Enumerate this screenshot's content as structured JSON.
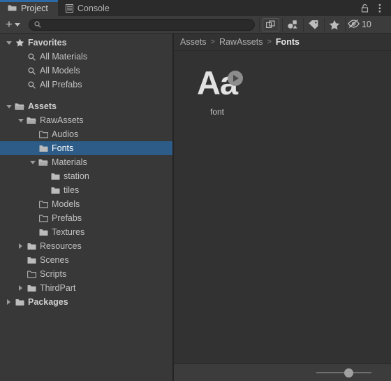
{
  "window": {
    "tabs": [
      {
        "label": "Project",
        "icon": "folder-icon",
        "active": true
      },
      {
        "label": "Console",
        "icon": "console-list-icon",
        "active": false
      }
    ],
    "lock_icon": "padlock-icon",
    "menu_icon": "kebab-menu-icon"
  },
  "toolbar": {
    "add_label": "+",
    "add_dropdown_icon": "chevron-down-icon",
    "search_value": "",
    "search_placeholder": "",
    "search_icon": "search-icon",
    "icons": [
      {
        "name": "open-in-new-window-icon"
      },
      {
        "name": "asset-type-filter-icon"
      },
      {
        "name": "label-tag-icon"
      },
      {
        "name": "favorite-star-icon"
      }
    ],
    "hidden_icon": "eye-slash-icon",
    "hidden_count": "10"
  },
  "tree": {
    "items": [
      {
        "label": "Favorites",
        "indent": 0,
        "twisty": "down",
        "icon": "star-icon",
        "bold": true,
        "selected": false
      },
      {
        "label": "All Materials",
        "indent": 1,
        "twisty": "none",
        "icon": "search-icon",
        "bold": false,
        "selected": false
      },
      {
        "label": "All Models",
        "indent": 1,
        "twisty": "none",
        "icon": "search-icon",
        "bold": false,
        "selected": false
      },
      {
        "label": "All Prefabs",
        "indent": 1,
        "twisty": "none",
        "icon": "search-icon",
        "bold": false,
        "selected": false
      },
      {
        "label": "Assets",
        "indent": 0,
        "twisty": "down",
        "icon": "folder-open-icon",
        "bold": true,
        "selected": false
      },
      {
        "label": "RawAssets",
        "indent": 1,
        "twisty": "down",
        "icon": "folder-open-icon",
        "bold": false,
        "selected": false
      },
      {
        "label": "Audios",
        "indent": 2,
        "twisty": "none",
        "icon": "folder-empty-icon",
        "bold": false,
        "selected": false
      },
      {
        "label": "Fonts",
        "indent": 2,
        "twisty": "none",
        "icon": "folder-icon",
        "bold": false,
        "selected": true
      },
      {
        "label": "Materials",
        "indent": 2,
        "twisty": "down",
        "icon": "folder-open-icon",
        "bold": false,
        "selected": false
      },
      {
        "label": "station",
        "indent": 3,
        "twisty": "none",
        "icon": "folder-icon",
        "bold": false,
        "selected": false
      },
      {
        "label": "tiles",
        "indent": 3,
        "twisty": "none",
        "icon": "folder-icon",
        "bold": false,
        "selected": false
      },
      {
        "label": "Models",
        "indent": 2,
        "twisty": "none",
        "icon": "folder-empty-icon",
        "bold": false,
        "selected": false
      },
      {
        "label": "Prefabs",
        "indent": 2,
        "twisty": "none",
        "icon": "folder-empty-icon",
        "bold": false,
        "selected": false
      },
      {
        "label": "Textures",
        "indent": 2,
        "twisty": "none",
        "icon": "folder-icon",
        "bold": false,
        "selected": false
      },
      {
        "label": "Resources",
        "indent": 1,
        "twisty": "right",
        "icon": "folder-icon",
        "bold": false,
        "selected": false
      },
      {
        "label": "Scenes",
        "indent": 1,
        "twisty": "none",
        "icon": "folder-icon",
        "bold": false,
        "selected": false
      },
      {
        "label": "Scripts",
        "indent": 1,
        "twisty": "none",
        "icon": "folder-empty-icon",
        "bold": false,
        "selected": false
      },
      {
        "label": "ThirdPart",
        "indent": 1,
        "twisty": "right",
        "icon": "folder-icon",
        "bold": false,
        "selected": false
      },
      {
        "label": "Packages",
        "indent": 0,
        "twisty": "right",
        "icon": "folder-icon",
        "bold": true,
        "selected": false
      }
    ]
  },
  "breadcrumb": {
    "separator": ">",
    "parts": [
      "Assets",
      "RawAssets",
      "Fonts"
    ]
  },
  "assets": [
    {
      "label": "font",
      "glyph": "Aa",
      "badge": "play-preview-icon"
    }
  ],
  "annotation": {
    "type": "arrow",
    "color": "#e81f1f",
    "points_to": "font-asset-thumbnail"
  },
  "zoom_slider": {
    "value": 60,
    "min": 0,
    "max": 100
  },
  "colors": {
    "panel_left": "#383838",
    "panel_right": "#323232",
    "toolbar": "#3c3c3c",
    "tabbar": "#2b2b2b",
    "selection": "#2c5c87",
    "tab_accent": "#2c6ba8",
    "arrow": "#e81f1f"
  }
}
